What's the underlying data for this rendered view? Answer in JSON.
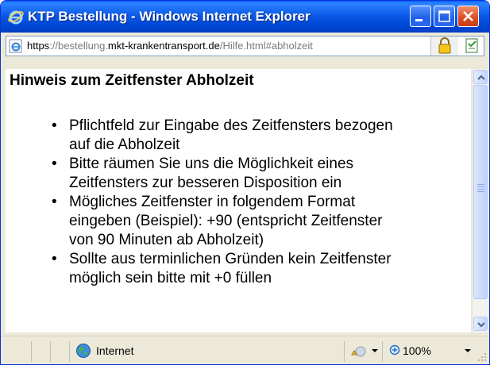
{
  "window": {
    "title": "KTP Bestellung - Windows Internet Explorer",
    "colors": {
      "titlebar": "#0054e3",
      "close_button": "#dd4c1e",
      "frame": "#ece9d8"
    }
  },
  "address_bar": {
    "url_scheme": "https",
    "url_sep": "://",
    "url_sub": "bestellung.",
    "url_domain": "mkt-krankentransport.de",
    "url_path": "/Hilfe.html#abholzeit",
    "page_icon": "ie-page-icon",
    "security_icon": "lock-icon",
    "certificate_icon": "certificate-icon"
  },
  "content": {
    "heading": "Hinweis zum Zeitfenster Abholzeit",
    "bullets": [
      [
        "Pflichtfeld zur Eingabe des Zeitfensters bezogen",
        "auf die Abholzeit"
      ],
      [
        "Bitte räumen Sie uns die Möglichkeit eines",
        "Zeitfensters zur besseren Disposition ein"
      ],
      [
        "Mögliches Zeitfenster in folgendem Format",
        "eingeben (Beispiel): +90 (entspricht Zeitfenster",
        "von 90 Minuten ab Abholzeit)"
      ],
      [
        "Sollte aus terminlichen Gründen kein Zeitfenster",
        "möglich sein bitte mit +0 füllen"
      ]
    ]
  },
  "status_bar": {
    "zone": "Internet",
    "zoom": "100%",
    "zone_icon": "globe-icon",
    "protected_mode_icon": "protected-mode-icon",
    "zoom_icon": "zoom-icon"
  }
}
